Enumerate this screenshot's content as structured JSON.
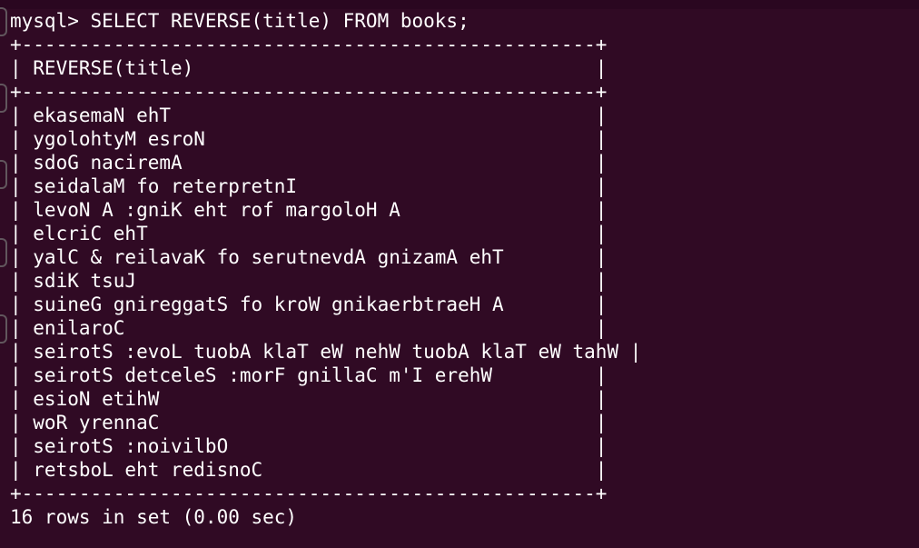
{
  "terminal": {
    "background": "#300a24",
    "foreground": "#ffffff",
    "command": "mysql> SELECT REVERSE(title) FROM books;",
    "table": {
      "separator": "+--------------------------------------------------+",
      "header": "| REVERSE(title)                                   |",
      "rows": [
        "| ekasemaN ehT                                     |",
        "| ygolohtyM esroN                                  |",
        "| sdoG naciremA                                    |",
        "| seidalaM fo reterpretnI                          |",
        "| levoN A :gniK eht rof margoloH A                 |",
        "| elcriC ehT                                       |",
        "| yalC & reilavaK fo serutnevdA gnizamA ehT        |",
        "| sdiK tsuJ                                        |",
        "| suineG gnireggatS fo kroW gnikaerbtraeH A        |",
        "| enilaroC                                         |",
        "| seirotS :evoL tuobA klaT eW nehW tuobA klaT eW tahW |",
        "| seirotS detceleS :morF gnillaC m'I erehW         |",
        "| esioN etihW                                      |",
        "| woR yrennaC                                      |",
        "| seirotS :noivilbO                                |",
        "| retsboL eht redisnoC                             |"
      ]
    },
    "footer": "16 rows in set (0.00 sec)"
  }
}
